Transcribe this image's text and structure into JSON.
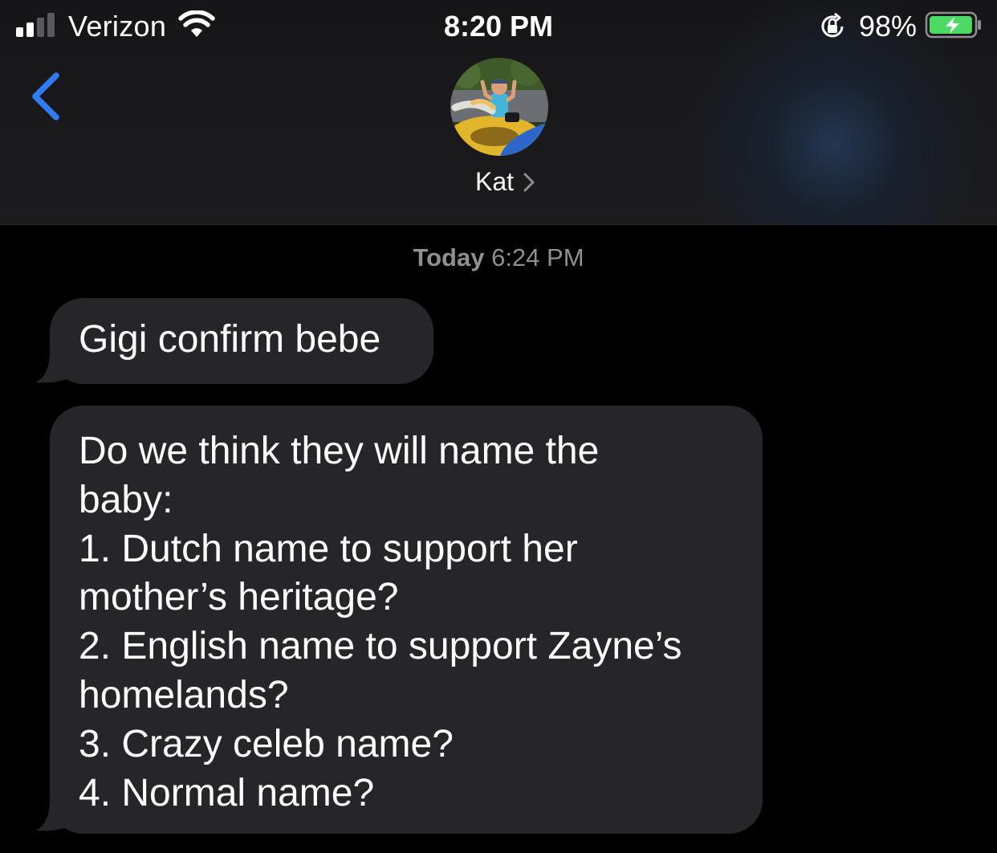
{
  "status_bar": {
    "carrier": "Verizon",
    "time": "8:20 PM",
    "battery_percent": "98%",
    "signal_bars_filled": 2,
    "signal_bars_total": 4,
    "battery_level": 0.98,
    "battery_charging": true
  },
  "header": {
    "contact_name": "Kat",
    "back_icon": "chevron-left-icon",
    "disclosure_icon": "chevron-right-icon"
  },
  "conversation": {
    "timestamp_day": "Today",
    "timestamp_time": "6:24 PM",
    "messages": [
      {
        "direction": "incoming",
        "lines": [
          "Gigi confirm bebe"
        ]
      },
      {
        "direction": "incoming",
        "lines": [
          "Do we think they will name the",
          "baby:",
          "1. Dutch name to support her",
          "mother’s heritage?",
          "2. English name to support Zayne’s",
          "homelands?",
          "3. Crazy celeb name?",
          "4. Normal name?"
        ]
      }
    ]
  },
  "colors": {
    "accent_blue": "#2f7cf6",
    "bubble_incoming": "#26252a",
    "timestamp_gray": "#8e8e93",
    "battery_green": "#4cd964"
  }
}
